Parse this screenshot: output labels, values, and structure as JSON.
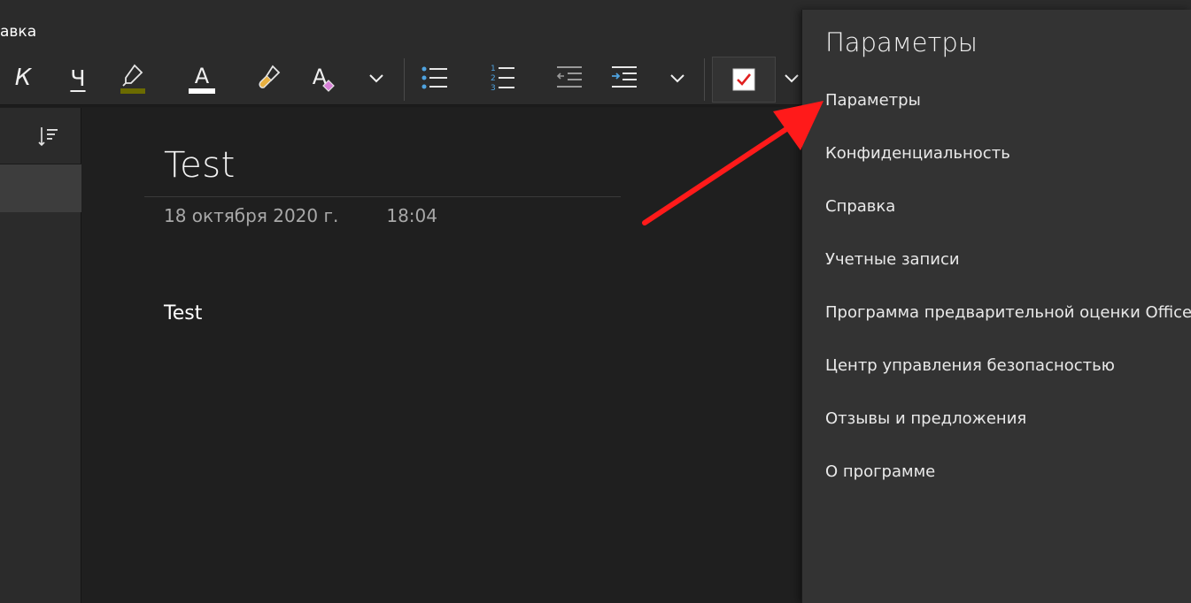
{
  "ribbon": {
    "tab_label_fragment": "авка",
    "italic_glyph": "К",
    "underline_glyph": "Ч",
    "font_color_glyph": "A",
    "style_glyph": "A",
    "numbered_list_digits": [
      "1",
      "2",
      "3"
    ],
    "highlight_color": "#6b6b00",
    "font_color_bar": "#ffffff",
    "accent_color": "#4fa3e0"
  },
  "note": {
    "title": "Test",
    "date": "18 октября 2020 г.",
    "time": "18:04",
    "body": "Test"
  },
  "settings": {
    "title": "Параметры",
    "items": [
      {
        "label": "Параметры"
      },
      {
        "label": "Конфиденциальность"
      },
      {
        "label": "Справка"
      },
      {
        "label": "Учетные записи"
      },
      {
        "label": "Программа предварительной оценки Office"
      },
      {
        "label": "Центр управления безопасностью"
      },
      {
        "label": "Отзывы и предложения"
      },
      {
        "label": "О программе"
      }
    ]
  },
  "annotation": {
    "arrow_color": "#ff1a1a"
  }
}
